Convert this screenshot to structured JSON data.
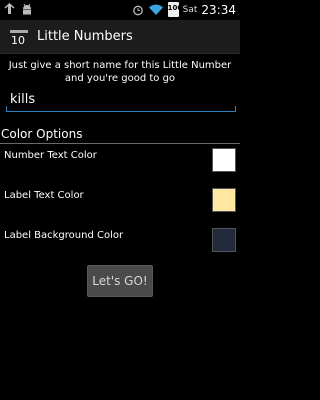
{
  "status_bar": {
    "battery_level": "100",
    "day": "Sat",
    "time": "23:34"
  },
  "action_bar": {
    "app_icon_text": "10",
    "title": "Little Numbers"
  },
  "form": {
    "instruction": "Just give a short name for this Little Number and you're good to go",
    "name_value": "kills"
  },
  "color_options": {
    "header": "Color Options",
    "items": [
      {
        "label": "Number Text Color",
        "color": "#ffffff"
      },
      {
        "label": "Label Text Color",
        "color": "#ffe9a0"
      },
      {
        "label": "Label Background Color",
        "color": "#232a3b"
      }
    ]
  },
  "go_button_label": "Let's GO!"
}
